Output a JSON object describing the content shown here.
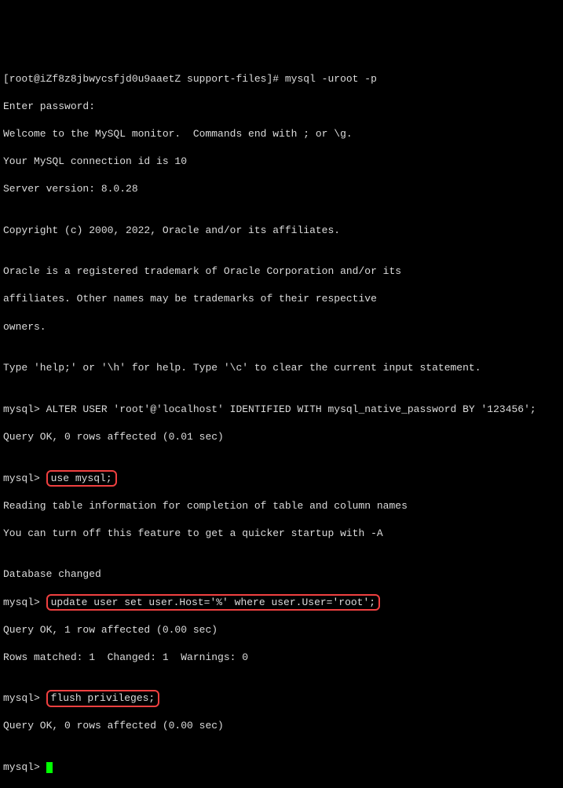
{
  "lines": {
    "l0": "[root@iZf8z8jbwycsfjd0u9aaetZ support-files]# mysql -uroot -p",
    "l1": "Enter password:",
    "l2": "Welcome to the MySQL monitor.  Commands end with ; or \\g.",
    "l3": "Your MySQL connection id is 10",
    "l4": "Server version: 8.0.28",
    "l5": "",
    "l6": "Copyright (c) 2000, 2022, Oracle and/or its affiliates.",
    "l7": "",
    "l8": "Oracle is a registered trademark of Oracle Corporation and/or its",
    "l9": "affiliates. Other names may be trademarks of their respective",
    "l10": "owners.",
    "l11": "",
    "l12": "Type 'help;' or '\\h' for help. Type '\\c' to clear the current input statement.",
    "l13": "",
    "l14": "mysql> ALTER USER 'root'@'localhost' IDENTIFIED WITH mysql_native_password BY '123456';",
    "l15": "Query OK, 0 rows affected (0.01 sec)",
    "l16": "",
    "l17_prompt": "mysql> ",
    "l17_cmd": "use mysql;",
    "l18": "Reading table information for completion of table and column names",
    "l19": "You can turn off this feature to get a quicker startup with -A",
    "l20": "",
    "l21": "Database changed",
    "l22_prompt": "mysql> ",
    "l22_cmd": "update user set user.Host='%' where user.User='root';",
    "l23": "Query OK, 1 row affected (0.00 sec)",
    "l24": "Rows matched: 1  Changed: 1  Warnings: 0",
    "l25": "",
    "l26_prompt": "mysql> ",
    "l26_cmd": "flush privileges;",
    "l27": "Query OK, 0 rows affected (0.00 sec)",
    "l28": "",
    "l29_prompt": "mysql> "
  },
  "chart_data": null
}
